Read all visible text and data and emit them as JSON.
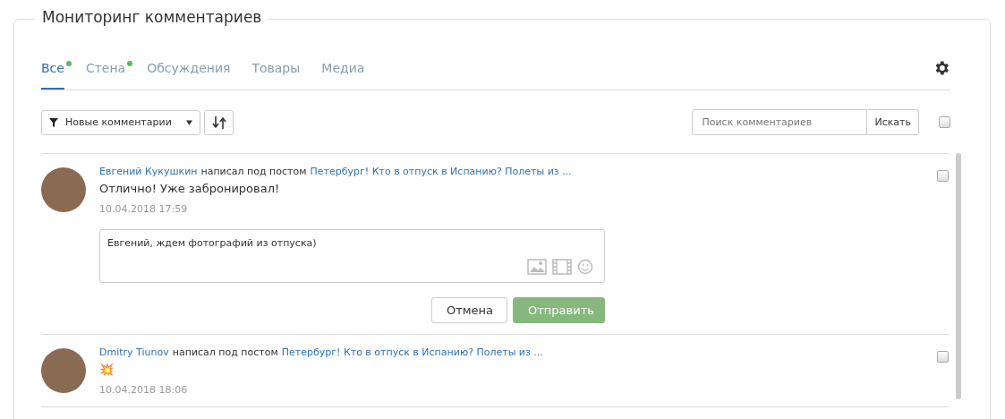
{
  "panel": {
    "title": "Мониторинг комментариев"
  },
  "tabs": [
    {
      "label": "Все",
      "selected": true,
      "new": true
    },
    {
      "label": "Стена",
      "selected": false,
      "new": true
    },
    {
      "label": "Обсуждения",
      "selected": false,
      "new": false
    },
    {
      "label": "Товары",
      "selected": false,
      "new": false
    },
    {
      "label": "Медиа",
      "selected": false,
      "new": false
    }
  ],
  "toolbar": {
    "filter": "Новые комментарии",
    "search": {
      "placeholder": "Поиск комментариев",
      "button": "Искать"
    },
    "select_all": {
      "checked": false
    }
  },
  "comments": [
    {
      "author": "Евгений Кукушкин",
      "connector": "написал под постом",
      "post": "Петербург! Кто в отпуск в Испанию? Полеты из ...",
      "text": "Отлично! Уже забронировал!",
      "time": "10.04.2018 17:59",
      "checked": false,
      "reply": {
        "value": "Евгений, ждем фотографий из отпуска)",
        "cancel": "Отмена",
        "send": "Отправить"
      }
    },
    {
      "author": "Dmitry Tiunov",
      "connector": "написал под постом",
      "post": "Петербург! Кто в отпуск в Испанию? Полеты из ...",
      "text": "💥",
      "time": "10.04.2018 18:06",
      "checked": false
    }
  ]
}
